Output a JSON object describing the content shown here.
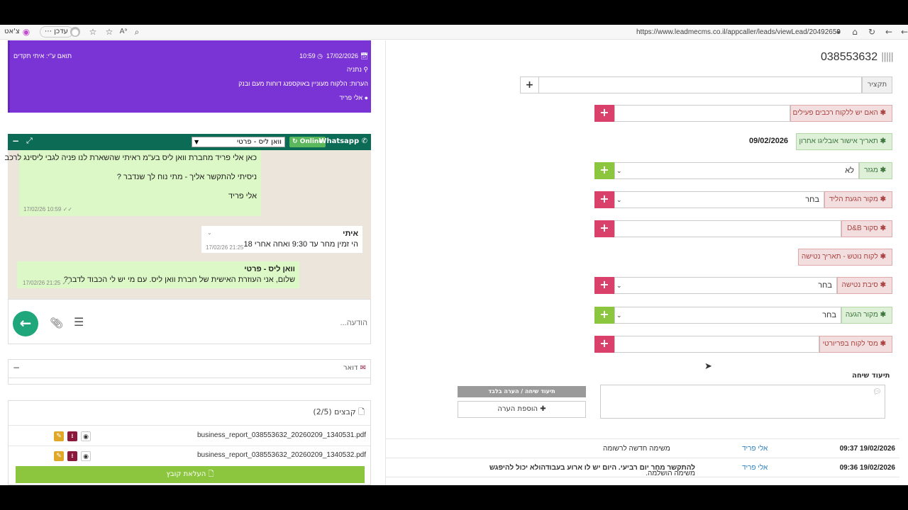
{
  "browser": {
    "url": "https://www.leadmecms.co.il/appcaller/leads/viewLead/20492659",
    "profile_label": "עדכן",
    "chat_label": "צ'אט"
  },
  "lead_card": {
    "date": "17/02/2026",
    "time": "10:59",
    "coordinator": "תואם ע\"י: איתי תקדים",
    "city": "נתניה",
    "notes": "הערות: הלקוח מעוניין באוקספנג דוחות מעם ובנק",
    "agent": "אלי פריד"
  },
  "whatsapp": {
    "title": "Whatsapp",
    "status": "Online",
    "selected_sender": "וואן ליס - פרטי",
    "messages": [
      {
        "lines": [
          "כאן אלי פריד מחברת וואן ליס בע\"מ ראיתי שהשארת לנו פניה לגבי ליסינג לרכב",
          "ניסיתי להתקשר אליך - מתי נוח לך שנדבר ?",
          "אלי פריד"
        ],
        "time": "17/02/26 10:59"
      },
      {
        "sender": "איתי",
        "text": "הי זמין מחר עד 9:30 ואחה אחרי 18",
        "time": "17/02/26 21:25"
      },
      {
        "sender": "וואן ליס - פרטי",
        "text": "שלום, אני העוזרת האישית של חברת וואן ליס. עם מי יש לי הכבוד לדבר?",
        "time": "17/02/26 21:25"
      }
    ],
    "composer_placeholder": "הודעה..."
  },
  "mail_panel": {
    "title": "דואר"
  },
  "files_panel": {
    "title": "קבצים (2/5)",
    "files": [
      "business_report_038553632_20260209_1340531.pdf",
      "business_report_038553632_20260209_1340532.pdf"
    ],
    "upload_label": "העלאת קובץ"
  },
  "lead": {
    "id": "038553632",
    "summary_placeholder": "תקציר",
    "fields": [
      {
        "label": "האם יש ללקוח רכבים פעילים",
        "value": "",
        "state": "red"
      },
      {
        "label": "תאריך אישור אובליגו אחרון",
        "value": "09/02/2026",
        "state": "green"
      },
      {
        "label": "מגזר",
        "value": "לא",
        "state": "green"
      },
      {
        "label": "מקור הגעת הליד",
        "value": "בחר",
        "state": "red"
      },
      {
        "label": "סקור D&B",
        "value": "",
        "state": "red"
      },
      {
        "label": "לקוח נוטש - תאריך נטישה",
        "value": "",
        "state": "red"
      },
      {
        "label": "סיבת נטישה",
        "value": "בחר",
        "state": "red"
      },
      {
        "label": "מקור הגעה",
        "value": "בחר",
        "state": "green"
      },
      {
        "label": "מס' לקוח בפריורטי",
        "value": "",
        "state": "red"
      }
    ],
    "call_doc_title": "תיעוד שיחה",
    "call_note_button": "תיעוד שיחה / הערה בלבד",
    "add_note_button": "הוספת הערה"
  },
  "history": [
    {
      "datetime": "09:37 19/02/2026",
      "agent": "אלי פריד",
      "text": "משימה חדשה לרשומה"
    },
    {
      "datetime": "09:36 19/02/2026",
      "agent": "אלי פריד",
      "text": "משימה הושלמה.",
      "bold": "להתקשר מחר יום רביעי. היום יש לו ארוע בעבודהולא יכול להיפגש"
    }
  ],
  "colors": {
    "purple": "#7a33d4",
    "whatsapp_green": "#0b6b55",
    "red": "#d9416b",
    "green": "#8cc63f",
    "upload": "#8cc63f"
  }
}
